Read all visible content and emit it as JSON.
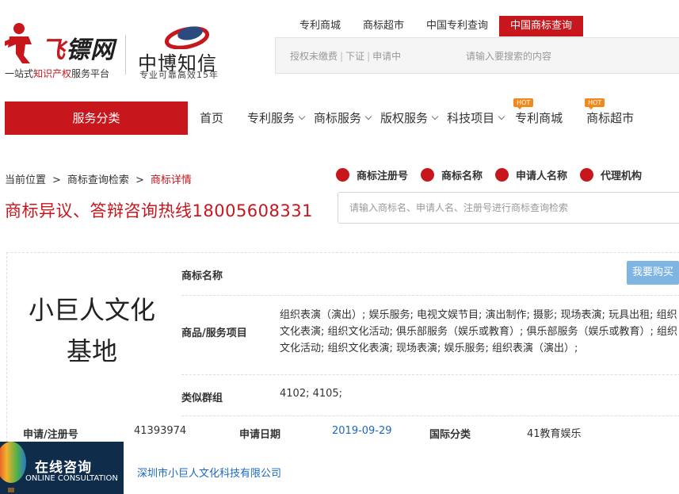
{
  "header": {
    "logo1": {
      "brand_fei": "飞",
      "brand_rest": "镖网",
      "slogan_a": "一站式",
      "slogan_b": "知识产权",
      "slogan_c": "服务平台"
    },
    "logo2": {
      "name": "中博知信",
      "sub": "专业可靠高效15年"
    },
    "top_links": [
      "专利商城",
      "商标超市",
      "中国专利查询",
      "中国商标查询"
    ],
    "search_hint": [
      "授权未缴费",
      "下证",
      "申请中"
    ],
    "search_placeholder": "请输入要搜索的内容"
  },
  "nav": {
    "category_button": "服务分类",
    "items": [
      {
        "label": "首页"
      },
      {
        "label": "专利服务"
      },
      {
        "label": "商标服务"
      },
      {
        "label": "版权服务"
      },
      {
        "label": "科技项目"
      },
      {
        "label": "专利商城",
        "badge": "HOT"
      },
      {
        "label": "商标超市",
        "badge": "HOT"
      }
    ]
  },
  "breadcrumb": [
    "当前位置",
    "商标查询检索",
    "商标详情"
  ],
  "filters": [
    "商标注册号",
    "商标名称",
    "申请人名称",
    "代理机构"
  ],
  "hotline": "商标异议、答辩咨询热线18005608331",
  "search2_placeholder": "请输入商标名、申请人名、注册号进行商标查询检索",
  "detail": {
    "trademark_image_text": [
      "小巨人文化",
      "基地"
    ],
    "name_label": "商标名称",
    "name_value": "",
    "buy_button": "我要购买",
    "goods_label": "商品/服务项目",
    "goods_value": "组织表演（演出）; 娱乐服务; 电视文娱节目; 演出制作; 摄影; 现场表演; 玩具出租; 组织文化表演; 组织文化活动; 俱乐部服务（娱乐或教育）; 俱乐部服务（娱乐或教育）; 组织文化活动; 组织文化表演; 现场表演; 娱乐服务; 组织表演（演出）;",
    "group_label": "类似群组",
    "group_value": "4102; 4105;",
    "regno_label": "申请/注册号",
    "regno_value": "41393974",
    "date_label": "申请日期",
    "date_value": "2019-09-29",
    "intl_label": "国际分类",
    "intl_value": "41教育娱乐",
    "applicant_value": "深圳市小巨人文化科技有限公司"
  },
  "consult": {
    "title": "在线咨询",
    "subtitle": "ONLINE CONSULTATION"
  },
  "colors": {
    "brand_red": "#c8161d",
    "link_blue": "#1a68c0",
    "buy_blue": "#7fb5e2",
    "hot_orange": "#f08a1c"
  }
}
